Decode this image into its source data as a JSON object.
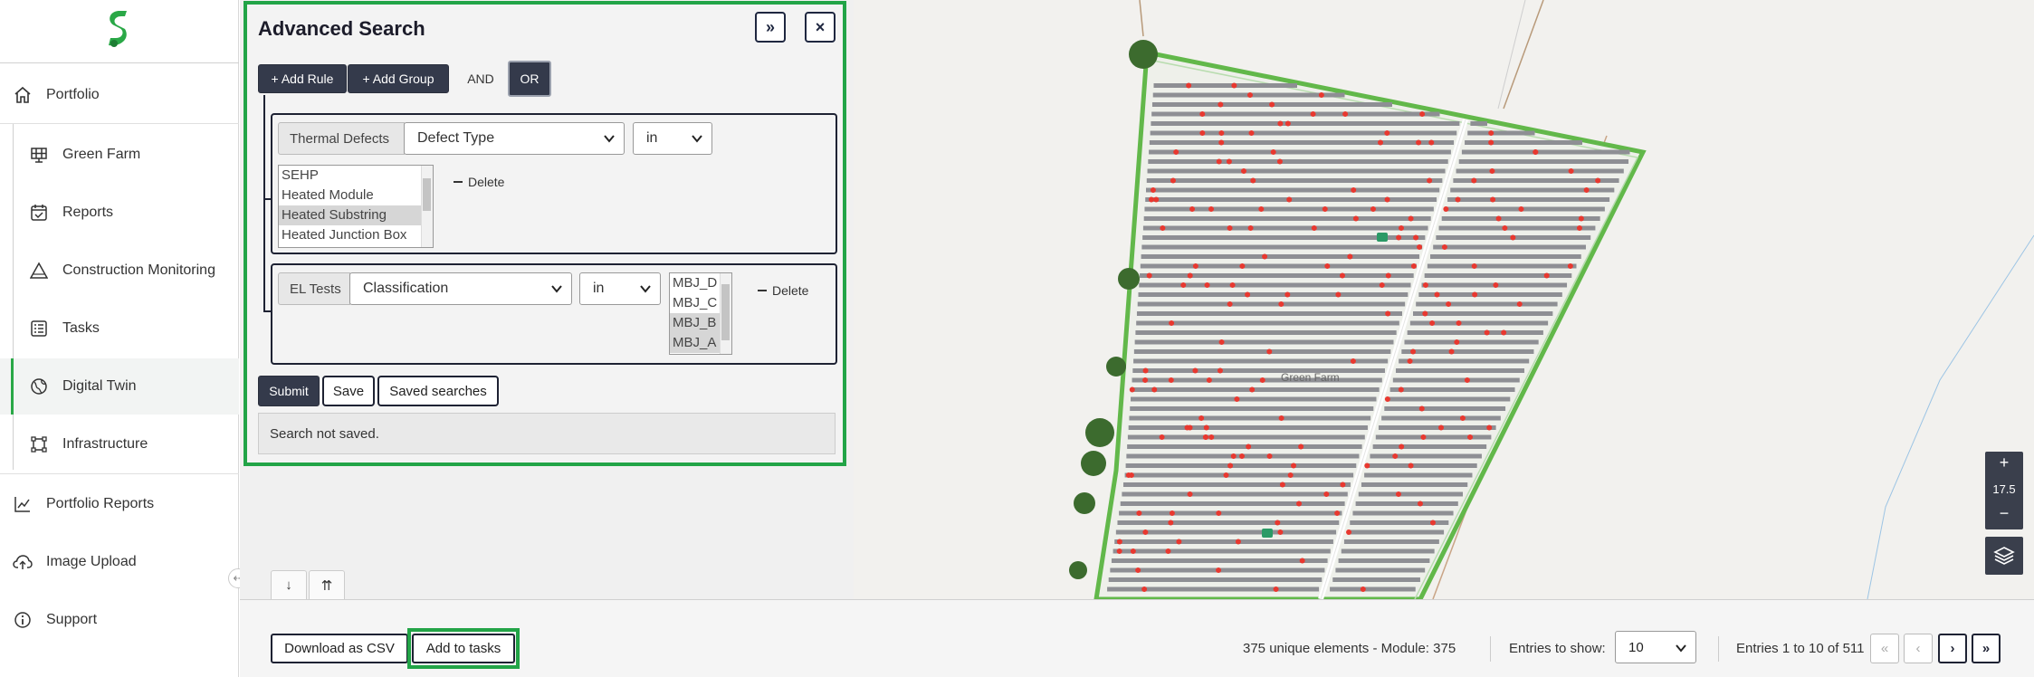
{
  "sidebar": {
    "items": [
      {
        "label": "Portfolio",
        "icon": "home-icon"
      },
      {
        "label": "Green Farm",
        "icon": "solar-panel-icon"
      },
      {
        "label": "Reports",
        "icon": "calendar-check-icon"
      },
      {
        "label": "Construction Monitoring",
        "icon": "warning-triangle-icon"
      },
      {
        "label": "Tasks",
        "icon": "list-icon"
      },
      {
        "label": "Digital Twin",
        "icon": "globe-icon"
      },
      {
        "label": "Infrastructure",
        "icon": "frame-icon"
      },
      {
        "label": "Portfolio Reports",
        "icon": "trend-chart-icon"
      },
      {
        "label": "Image Upload",
        "icon": "cloud-upload-icon"
      },
      {
        "label": "Support",
        "icon": "info-icon"
      }
    ],
    "active": "Digital Twin",
    "brand_color": "#2aa847",
    "collapse_glyph": "⇠"
  },
  "search_panel": {
    "title": "Advanced Search",
    "expand_glyph": "»",
    "close_glyph": "×",
    "add_rule_label": "+ Add Rule",
    "add_group_label": "+ Add Group",
    "and_label": "AND",
    "or_label": "OR",
    "selected_conjunction": "OR",
    "rules": [
      {
        "category": "Thermal Defects",
        "field": "Defect Type",
        "operator": "in",
        "options": [
          "SEHP",
          "Heated Module",
          "Heated Substring",
          "Heated Junction Box"
        ],
        "selected": [
          "Heated Substring"
        ],
        "delete_label": "Delete"
      },
      {
        "category": "EL Tests",
        "field": "Classification",
        "operator": "in",
        "options": [
          "MBJ_D",
          "MBJ_C",
          "MBJ_B",
          "MBJ_A"
        ],
        "selected": [
          "MBJ_B",
          "MBJ_A"
        ],
        "delete_label": "Delete"
      }
    ],
    "submit_label": "Submit",
    "save_label": "Save",
    "saved_searches_label": "Saved searches",
    "status_text": "Search not saved.",
    "highlight_color": "#22a447"
  },
  "map": {
    "site_label": "Green Farm",
    "zoom_in": "+",
    "zoom_level": "17.5",
    "zoom_out": "−",
    "layers_icon": "layers-icon",
    "tabs": [
      "↓",
      "⇈"
    ]
  },
  "footer": {
    "download_csv_label": "Download as CSV",
    "add_to_tasks_label": "Add to tasks",
    "stats_text": "375 unique elements - Module: 375",
    "entries_label": "Entries to show:",
    "entries_value": "10",
    "range_text": "Entries 1 to 10 of 511",
    "pager": [
      "«",
      "‹",
      "›",
      "»"
    ]
  }
}
